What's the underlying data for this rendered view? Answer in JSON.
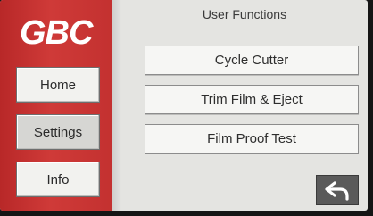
{
  "brand": {
    "logo_text": "GBC",
    "accent_color": "#c83434"
  },
  "sidebar": {
    "items": [
      {
        "label": "Home",
        "selected": false
      },
      {
        "label": "Settings",
        "selected": true
      },
      {
        "label": "Info",
        "selected": false
      }
    ]
  },
  "main": {
    "title": "User Functions",
    "actions": [
      {
        "label": "Cycle Cutter"
      },
      {
        "label": "Trim Film & Eject"
      },
      {
        "label": "Film Proof Test"
      }
    ],
    "back_icon": "back-arrow-icon"
  }
}
